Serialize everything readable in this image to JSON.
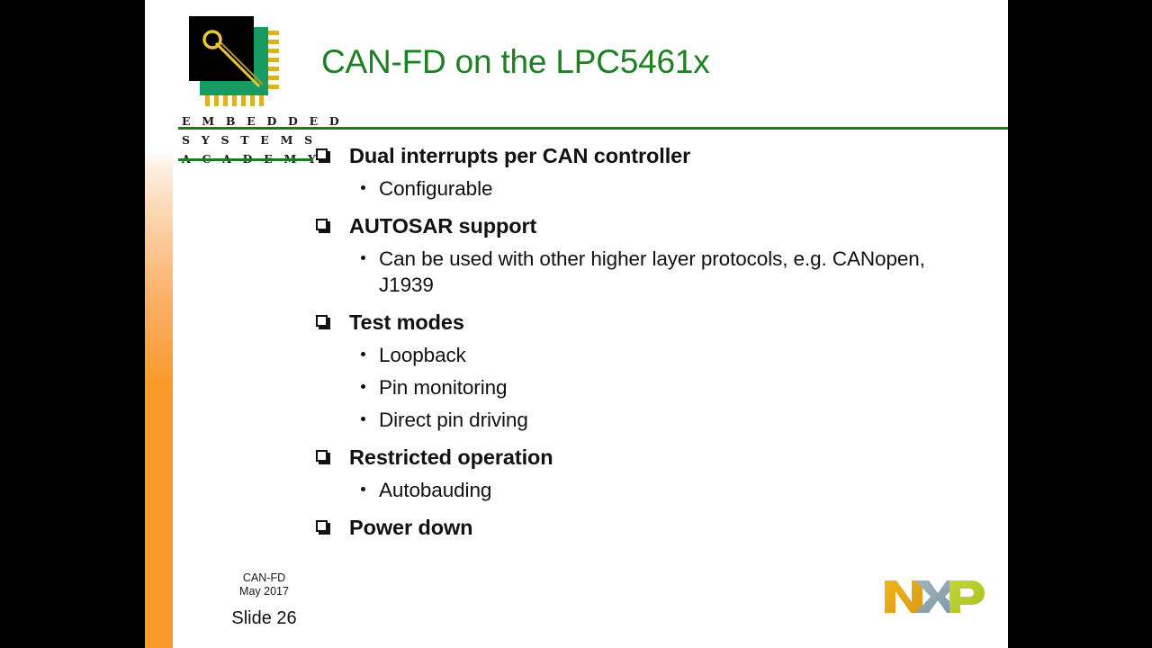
{
  "slide": {
    "title": "CAN-FD on the LPC5461x",
    "title_color": "#1d8022",
    "accent_rule_color": "#1d7a1f",
    "strip_color": "#f99a2b",
    "background": "#ffffff"
  },
  "logo": {
    "wordmark_lines": [
      "E M B E D D E D",
      "S Y S T E M S",
      "A C A D E M Y"
    ],
    "chip_body_color": "#000000",
    "chip_pad_color": "#1a9a63",
    "chip_pin_color": "#d9b22a",
    "chip_probe_color": "#e8c53a"
  },
  "content": {
    "bullets": [
      {
        "level": 1,
        "text": "Dual interrupts per CAN controller",
        "children": [
          {
            "level": 2,
            "text": "Configurable"
          }
        ]
      },
      {
        "level": 1,
        "text": "AUTOSAR support",
        "children": [
          {
            "level": 2,
            "text": "Can be used with other higher layer protocols, e.g. CANopen, J1939"
          }
        ]
      },
      {
        "level": 1,
        "text": "Test modes",
        "children": [
          {
            "level": 2,
            "text": "Loopback"
          },
          {
            "level": 2,
            "text": "Pin monitoring"
          },
          {
            "level": 2,
            "text": "Direct pin driving"
          }
        ]
      },
      {
        "level": 1,
        "text": "Restricted operation",
        "children": [
          {
            "level": 2,
            "text": "Autobauding"
          }
        ]
      },
      {
        "level": 1,
        "text": "Power down",
        "children": []
      }
    ]
  },
  "footer": {
    "deck_name": "CAN-FD",
    "deck_date": "May 2017",
    "slide_number": "Slide 26"
  },
  "nxp": {
    "letters": [
      "N",
      "X",
      "P"
    ],
    "n_color": "#e8a91d",
    "x_color": "#8ca3b0",
    "p_color": "#b5cc2e"
  }
}
